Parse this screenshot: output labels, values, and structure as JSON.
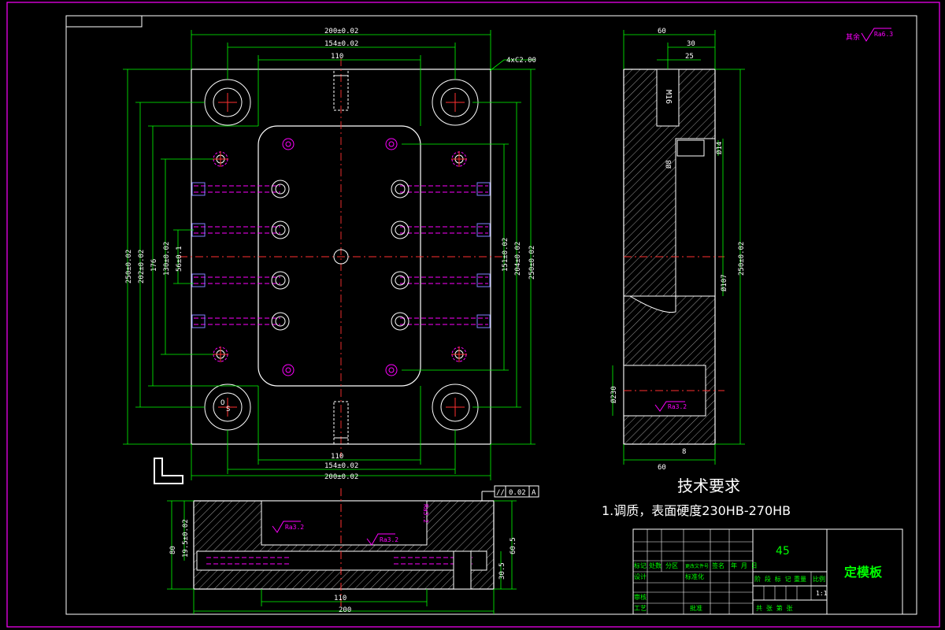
{
  "drawing": {
    "title_block": {
      "material": "45",
      "part_name": "定模板",
      "scale": "1:1",
      "labels": {
        "marks": "标记",
        "count": "处数",
        "zone": "分区",
        "change_doc": "更改文件号",
        "signature": "签名",
        "date": "年 月 日",
        "design": "设计",
        "standardize": "标准化",
        "check": "审核",
        "process": "工艺",
        "approve": "批准",
        "stage_mark": "阶 段 标 记",
        "weight": "重量",
        "ratio": "比例",
        "sheets": "共  张  第  张"
      }
    },
    "tech_req": {
      "heading": "技术要求",
      "item1": "1.调质，表面硬度230HB-270HB"
    },
    "roughness": {
      "default": "其余",
      "ra63": "Ra6.3",
      "ra32": "Ra3.2"
    },
    "tolerance_frame": {
      "symbol": "//",
      "value": "0.02",
      "datum": "A"
    },
    "dims": {
      "w200": "200±0.02",
      "w154": "154±0.02",
      "w110": "110",
      "chamfer": "4xC2.00",
      "h250": "250±0.02",
      "h202": "202±0.02",
      "h176": "176",
      "h130": "130±0.02",
      "h56": "56±0.1",
      "h151": "151±0.02",
      "h204": "204±0.02",
      "side_60": "60",
      "side_30": "30",
      "side_25": "25",
      "m16": "M16",
      "d14": "Ø14",
      "d8": "Ø8",
      "d107": "Ø107",
      "d230": "Ø230",
      "r8": "8",
      "sec_80": "80",
      "sec_195": "19.5±0.02",
      "sec_605": "60.5",
      "sec_305": "30.5",
      "sec_200": "200",
      "sec_110": "110"
    },
    "view_labels": {
      "o": "O",
      "s": "S"
    }
  }
}
